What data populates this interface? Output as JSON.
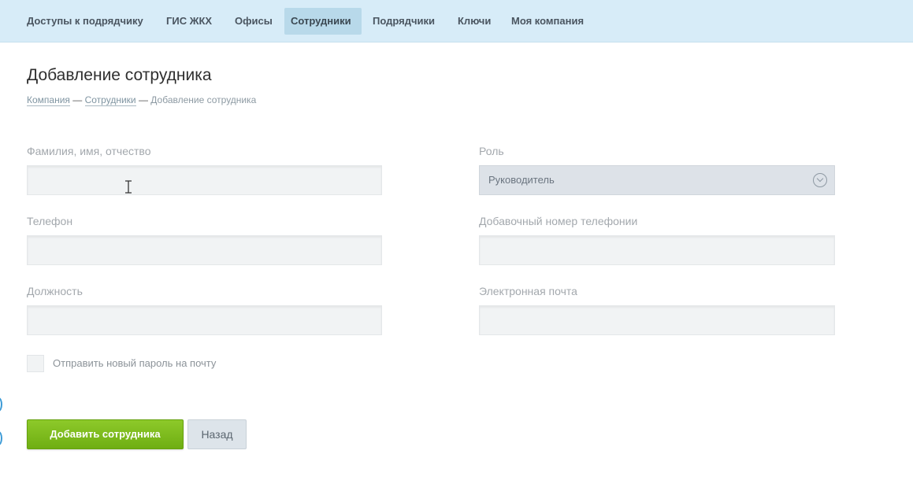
{
  "nav": {
    "items": [
      {
        "label": "Доступы к подрядчику",
        "active": false
      },
      {
        "label": "ГИС ЖКХ",
        "active": false
      },
      {
        "label": "Офисы",
        "active": false
      },
      {
        "label": "Сотрудники",
        "active": true
      },
      {
        "label": "Подрядчики",
        "active": false
      },
      {
        "label": "Ключи",
        "active": false
      },
      {
        "label": "Моя компания",
        "active": false
      }
    ]
  },
  "page": {
    "title": "Добавление сотрудника",
    "breadcrumb": {
      "company": "Компания",
      "employees": "Сотрудники",
      "current": "Добавление сотрудника",
      "separator": "—"
    }
  },
  "form": {
    "full_name": {
      "label": "Фамилия, имя, отчество",
      "value": ""
    },
    "role": {
      "label": "Роль",
      "value": "Руководитель"
    },
    "phone": {
      "label": "Телефон",
      "value": ""
    },
    "extension": {
      "label": "Добавочный номер телефонии",
      "value": ""
    },
    "position": {
      "label": "Должность",
      "value": ""
    },
    "email": {
      "label": "Электронная почта",
      "value": ""
    },
    "send_password": {
      "label": "Отправить новый пароль на почту",
      "checked": false
    }
  },
  "actions": {
    "add_label": "Добавить сотрудника",
    "back_label": "Назад"
  },
  "colors": {
    "nav_bg": "#d7ecf8",
    "primary_button": "#7dbb1e"
  }
}
